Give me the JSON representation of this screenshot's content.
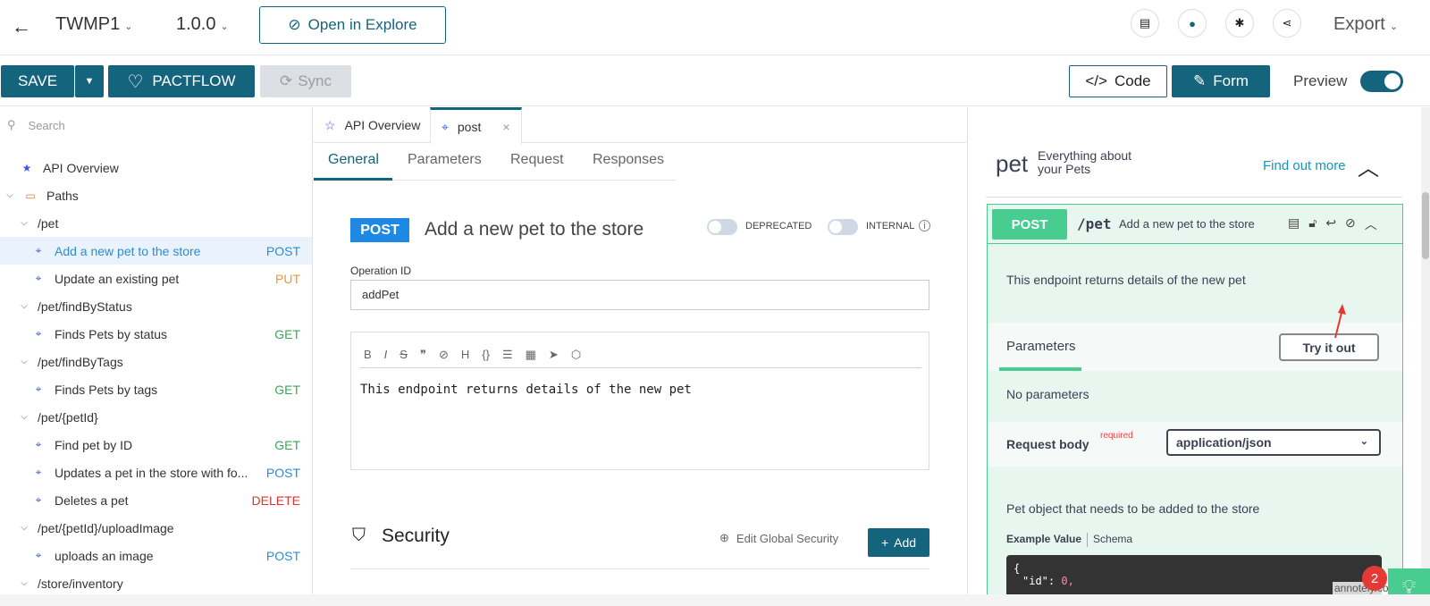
{
  "header": {
    "back_icon": "arrow-left-icon",
    "project": "TWMP1",
    "version": "1.0.0",
    "explore_label": "Open in Explore",
    "export_label": "Export"
  },
  "toolbar": {
    "save_label": "SAVE",
    "pactflow_label": "PACTFLOW",
    "sync_label": "Sync",
    "code_label": "Code",
    "form_label": "Form",
    "preview_label": "Preview",
    "preview_on": true
  },
  "sidebar": {
    "search_placeholder": "Search",
    "overview": "API Overview",
    "paths_label": "Paths",
    "groups": [
      {
        "path": "/pet"
      },
      {
        "path": "/pet/findByStatus"
      },
      {
        "path": "/pet/findByTags"
      },
      {
        "path": "/pet/{petId}"
      },
      {
        "path": "/pet/{petId}/uploadImage"
      },
      {
        "path": "/store/inventory"
      }
    ],
    "ops": [
      {
        "label": "Add a new pet to the store",
        "method": "POST"
      },
      {
        "label": "Update an existing pet",
        "method": "PUT"
      },
      {
        "label": "Finds Pets by status",
        "method": "GET"
      },
      {
        "label": "Finds Pets by tags",
        "method": "GET"
      },
      {
        "label": "Find pet by ID",
        "method": "GET"
      },
      {
        "label": "Updates a pet in the store with fo...",
        "method": "POST"
      },
      {
        "label": "Deletes a pet",
        "method": "DELETE"
      },
      {
        "label": "uploads an image",
        "method": "POST"
      }
    ]
  },
  "editor": {
    "tabs": [
      {
        "label": "API Overview"
      },
      {
        "label": "post",
        "close": "×"
      }
    ],
    "subtabs": [
      "General",
      "Parameters",
      "Request",
      "Responses"
    ],
    "method": "POST",
    "title": "Add a new pet to the store",
    "deprecated_label": "DEPRECATED",
    "internal_label": "INTERNAL",
    "operation_id_label": "Operation ID",
    "operation_id": "addPet",
    "md_tools": [
      "B",
      "I",
      "S",
      "❞",
      "⊘",
      "H",
      "{}",
      "☰",
      "▦",
      "➤",
      "⬡"
    ],
    "description": "This endpoint returns details of the new pet",
    "security_title": "Security",
    "edit_global_security": "Edit Global Security",
    "add_label": "Add"
  },
  "preview": {
    "tag": "pet",
    "tag_desc": "Everything about your Pets",
    "find_more": "Find out more",
    "method": "POST",
    "path": "/pet",
    "summary": "Add a new pet to the store",
    "description": "This endpoint returns details of the new pet",
    "params_label": "Parameters",
    "try_label": "Try it out",
    "no_params": "No parameters",
    "request_body": "Request body",
    "required": "required",
    "content_type": "application/json",
    "body_desc": "Pet object that needs to be added to the store",
    "example_value": "Example Value",
    "schema": "Schema",
    "code_line1": "{",
    "code_key": "\"id\"",
    "code_val": "0,"
  },
  "overlay": {
    "badge_count": "2",
    "watermark": "annotely.com"
  },
  "colors": {
    "accent": "#14647d",
    "post_green": "#49cc90",
    "post_blue": "#1e88e5"
  }
}
